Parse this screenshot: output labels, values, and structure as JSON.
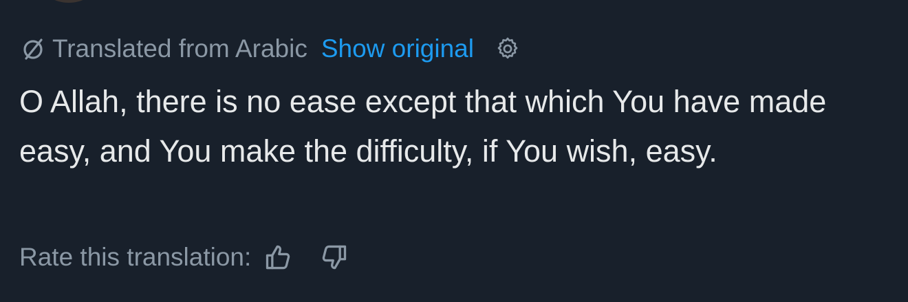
{
  "translation_bar": {
    "icon": "translate-icon",
    "label": "Translated from Arabic",
    "show_original_label": "Show original",
    "settings_icon": "gear-icon"
  },
  "tweet": {
    "text": "O Allah, there is no ease except that which You have made easy, and You make the difficulty, if You wish, easy."
  },
  "rating": {
    "label": "Rate this translation:",
    "thumbs_up_icon": "thumbs-up-icon",
    "thumbs_down_icon": "thumbs-down-icon"
  },
  "colors": {
    "background": "#18202b",
    "text_primary": "#e7e9ea",
    "text_secondary": "#8b98a5",
    "link": "#1d9bf0"
  }
}
